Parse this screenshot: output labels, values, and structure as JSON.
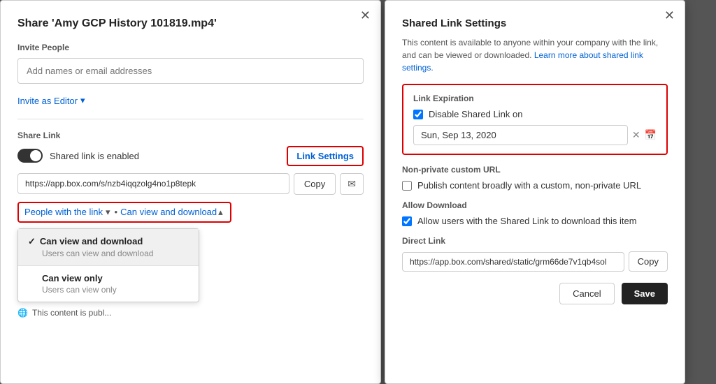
{
  "left_dialog": {
    "title": "Share 'Amy GCP History 101819.mp4'",
    "invite_section": {
      "label": "Invite People",
      "input_placeholder": "Add names or email addresses",
      "invite_editor_label": "Invite as Editor",
      "invite_editor_arrow": "▾"
    },
    "share_link_section": {
      "label": "Share Link",
      "toggle_label": "Shared link is enabled",
      "link_settings_label": "Link Settings",
      "url_value": "https://app.box.com/s/nzb4iqqzolg4no1p8tepk",
      "copy_label": "Copy",
      "email_icon": "✉",
      "people_with_link": "People with the link",
      "access_level": "Can view and download",
      "public_info": "This content is publ..."
    },
    "dropdown": {
      "option1_title": "Can view and download",
      "option1_desc": "Users can view and download",
      "option1_selected": true,
      "option2_title": "Can view only",
      "option2_desc": "Users can view only",
      "option2_selected": false
    }
  },
  "right_dialog": {
    "title": "Shared Link Settings",
    "description": "This content is available to anyone within your company with the link, and can be viewed or downloaded.",
    "learn_more_label": "Learn more about shared link settings.",
    "link_expiration": {
      "section_title": "Link Expiration",
      "checkbox_label": "Disable Shared Link on",
      "checkbox_checked": true,
      "date_value": "Sun, Sep 13, 2020",
      "clear_icon": "✕",
      "calendar_icon": "📅"
    },
    "non_private_url": {
      "section_title": "Non-private custom URL",
      "checkbox_label": "Publish content broadly with a custom, non-private URL",
      "checkbox_checked": false
    },
    "allow_download": {
      "section_title": "Allow Download",
      "checkbox_label": "Allow users with the Shared Link to download this item",
      "checkbox_checked": true
    },
    "direct_link": {
      "section_title": "Direct Link",
      "url_value": "https://app.box.com/shared/static/grm66de7v1qb4sol",
      "copy_label": "Copy"
    },
    "footer": {
      "cancel_label": "Cancel",
      "save_label": "Save"
    }
  }
}
